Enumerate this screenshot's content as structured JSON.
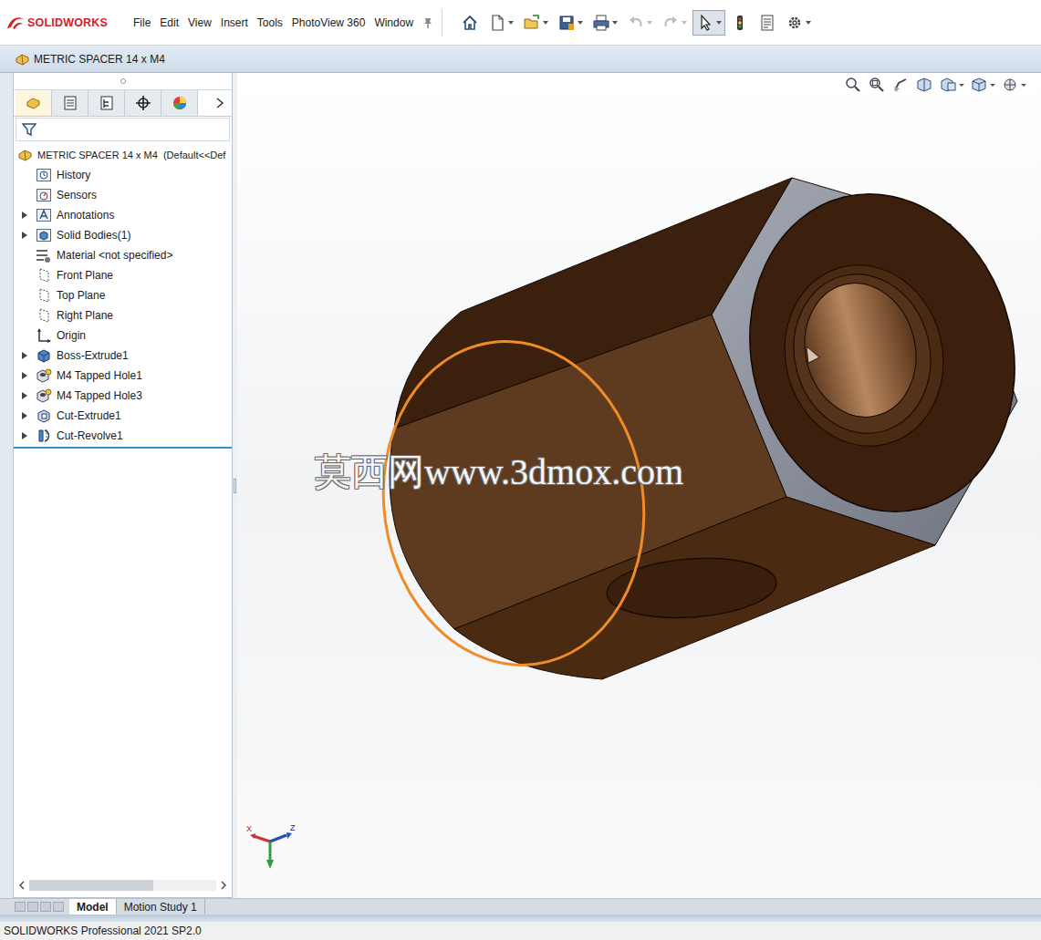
{
  "app": {
    "brand": "SOLIDWORKS"
  },
  "menu": [
    "File",
    "Edit",
    "View",
    "Insert",
    "Tools",
    "PhotoView 360",
    "Window"
  ],
  "toolbar": [
    {
      "kind": "home",
      "dropdown": false,
      "disabled": false,
      "selected": false
    },
    {
      "kind": "new",
      "dropdown": true,
      "disabled": false,
      "selected": false
    },
    {
      "kind": "open",
      "dropdown": true,
      "disabled": false,
      "selected": false
    },
    {
      "kind": "save",
      "dropdown": true,
      "disabled": false,
      "selected": false
    },
    {
      "kind": "print",
      "dropdown": true,
      "disabled": false,
      "selected": false
    },
    {
      "kind": "undo",
      "dropdown": true,
      "disabled": true,
      "selected": false
    },
    {
      "kind": "redo",
      "dropdown": true,
      "disabled": true,
      "selected": false
    },
    {
      "kind": "select",
      "dropdown": true,
      "disabled": false,
      "selected": true
    },
    {
      "kind": "rebuild",
      "dropdown": false,
      "disabled": false,
      "selected": false
    },
    {
      "kind": "file-properties",
      "dropdown": false,
      "disabled": false,
      "selected": false
    },
    {
      "kind": "options",
      "dropdown": true,
      "disabled": false,
      "selected": false
    }
  ],
  "document": {
    "title": "METRIC SPACER 14 x M4"
  },
  "panel_tabs": [
    {
      "kind": "feature-manager",
      "selected": true
    },
    {
      "kind": "property-manager",
      "selected": false
    },
    {
      "kind": "configuration-manager",
      "selected": false
    },
    {
      "kind": "dimxpert-manager",
      "selected": false
    },
    {
      "kind": "display-manager",
      "selected": false
    }
  ],
  "tree": {
    "root": "METRIC SPACER 14 x M4  (Default<<Def",
    "items": [
      {
        "label": "History",
        "kind": "history",
        "expandable": false,
        "expanded": false
      },
      {
        "label": "Sensors",
        "kind": "sensors",
        "expandable": false,
        "expanded": false
      },
      {
        "label": "Annotations",
        "kind": "annotations",
        "expandable": true,
        "expanded": false
      },
      {
        "label": "Solid Bodies(1)",
        "kind": "solid-bodies",
        "expandable": true,
        "expanded": false
      },
      {
        "label": "Material <not specified>",
        "kind": "material",
        "expandable": false,
        "expanded": false
      },
      {
        "label": "Front Plane",
        "kind": "plane",
        "expandable": false,
        "expanded": false
      },
      {
        "label": "Top Plane",
        "kind": "plane",
        "expandable": false,
        "expanded": false
      },
      {
        "label": "Right Plane",
        "kind": "plane",
        "expandable": false,
        "expanded": false
      },
      {
        "label": "Origin",
        "kind": "origin",
        "expandable": false,
        "expanded": false
      },
      {
        "label": "Boss-Extrude1",
        "kind": "extrude",
        "expandable": true,
        "expanded": false
      },
      {
        "label": "M4 Tapped Hole1",
        "kind": "hole",
        "expandable": true,
        "expanded": false
      },
      {
        "label": "M4 Tapped Hole3",
        "kind": "hole",
        "expandable": true,
        "expanded": false
      },
      {
        "label": "Cut-Extrude1",
        "kind": "cut-extrude",
        "expandable": true,
        "expanded": false
      },
      {
        "label": "Cut-Revolve1",
        "kind": "revolve",
        "expandable": true,
        "expanded": false
      }
    ]
  },
  "viewport": {
    "watermark": "莫西网www.3dmox.com",
    "edge_selected": true,
    "triad": [
      "X",
      "Z"
    ]
  },
  "bottom_tabs": [
    {
      "label": "Model",
      "selected": true
    },
    {
      "label": "Motion Study 1",
      "selected": false
    }
  ],
  "status_bar": "SOLIDWORKS Professional 2021 SP2.0"
}
